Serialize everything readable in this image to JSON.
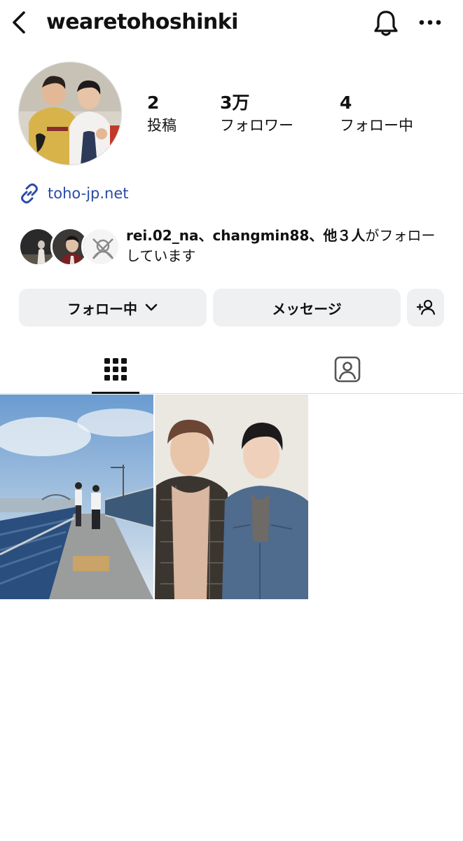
{
  "header": {
    "username": "wearetohoshinki",
    "back_icon": "chevron-left-icon",
    "bell_icon": "bell-icon",
    "more_icon": "more-horizontal-icon"
  },
  "stats": [
    {
      "value": "2",
      "label": "投稿"
    },
    {
      "value": "3万",
      "label": "フォロワー"
    },
    {
      "value": "4",
      "label": "フォロー中"
    }
  ],
  "link": {
    "text": "toho-jp.net",
    "icon": "link-icon",
    "color": "#2b4aa8"
  },
  "followed_by": {
    "names": "rei.02_na、changmin88、他３人",
    "suffix": "がフォローしています"
  },
  "actions": {
    "following_label": "フォロー中",
    "message_label": "メッセージ",
    "add_user_icon": "person-add-icon"
  },
  "tabs": [
    {
      "icon": "grid-icon",
      "active": true
    },
    {
      "icon": "tagged-person-icon",
      "active": false
    }
  ],
  "posts": [
    {
      "type": "photo",
      "subject": "two people on stadium stand by river"
    },
    {
      "type": "photo",
      "subject": "two men portrait"
    }
  ]
}
